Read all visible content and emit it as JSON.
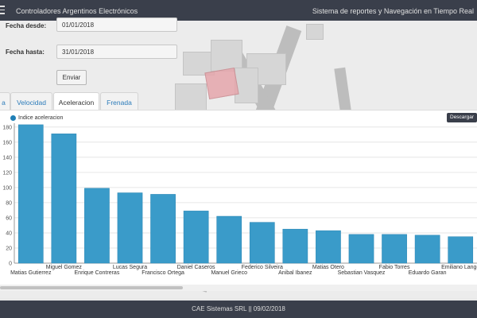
{
  "header": {
    "brand": "Controladores Argentinos Electrónicos",
    "title": "Sistema de reportes y Navegación en Tiempo Real"
  },
  "form": {
    "from_label": "Fecha desde:",
    "from_value": "01/01/2018",
    "to_label": "Fecha hasta:",
    "to_value": "31/01/2018",
    "submit_label": "Enviar"
  },
  "tabs": [
    {
      "label": "a"
    },
    {
      "label": "Velocidad"
    },
    {
      "label": "Aceleracion"
    },
    {
      "label": "Frenada"
    }
  ],
  "download_label": "Descargar",
  "footer": {
    "text": "CAE Sistemas SRL || 09/02/2018"
  },
  "colors": {
    "bar": "#3a9bc9",
    "legend": "#1f7fb6",
    "bar_stroke": "#2a85b3"
  },
  "chart_data": {
    "type": "bar",
    "series": [
      {
        "name": "Indice aceleracion",
        "values": [
          183,
          171,
          99,
          93,
          91,
          69,
          62,
          54,
          45,
          43,
          38,
          38,
          37,
          35
        ]
      }
    ],
    "categories": [
      "Matias Gutierrez",
      "Miguel Gomez",
      "Enrique Contreras",
      "Lucas Segura",
      "Francisco Ortega",
      "Daniel Caseros",
      "Manuel Grieco",
      "Federico Silveira",
      "Anibal Ibanez",
      "Matias Otero",
      "Sebastian Vasquez",
      "Fabio Torres",
      "Eduardo Garan",
      "Emiliano Lango"
    ],
    "yticks": [
      0,
      20,
      40,
      60,
      80,
      100,
      120,
      140,
      160,
      180
    ],
    "ylim": [
      0,
      185
    ],
    "grid": true,
    "legend_position": "top-left"
  }
}
